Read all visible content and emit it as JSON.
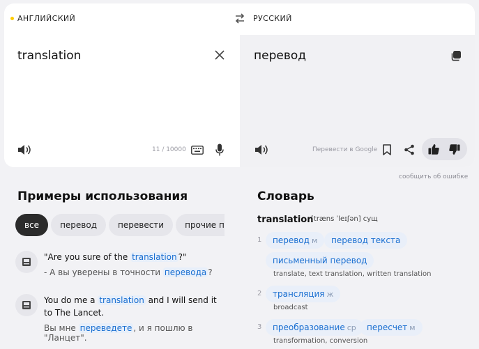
{
  "languages": {
    "source": "АНГЛИЙСКИЙ",
    "target": "РУССКИЙ"
  },
  "source": {
    "text": "translation",
    "counter": "11 / 10000"
  },
  "target": {
    "text": "перевод",
    "google_link": "Перевести в Google"
  },
  "report_link": "сообщить об ошибке",
  "examples": {
    "title": "Примеры использования",
    "chips": [
      "все",
      "перевод",
      "перевести",
      "прочие пере"
    ],
    "items": [
      {
        "en_pre": "\"Are you sure of the ",
        "en_hl": "translation",
        "en_post": "?\"",
        "ru_pre": "- А вы уверены в точности ",
        "ru_hl": "перевода",
        "ru_post": "?"
      },
      {
        "en_pre": "You do me a ",
        "en_hl": "translation",
        "en_post": " and I will send it to The Lancet.",
        "ru_pre": "Вы мне ",
        "ru_hl": "переведете",
        "ru_post": ", и я пошлю в \"Ланцет\"."
      }
    ]
  },
  "dictionary": {
    "title": "Словарь",
    "word": "translation",
    "transcription": "[træns ˈleɪʃən] сущ",
    "senses": [
      {
        "num": "1",
        "t1": "перевод",
        "g1": "м",
        "t2": "перевод текста",
        "t3": "письменный перевод",
        "gloss": "translate, text translation, written translation"
      },
      {
        "num": "2",
        "t1": "трансляция",
        "g1": "ж",
        "gloss": "broadcast"
      },
      {
        "num": "3",
        "t1": "преобразование",
        "g1": "ср",
        "t2": "пересчет",
        "g2": "м",
        "gloss": "transformation, conversion"
      }
    ]
  }
}
